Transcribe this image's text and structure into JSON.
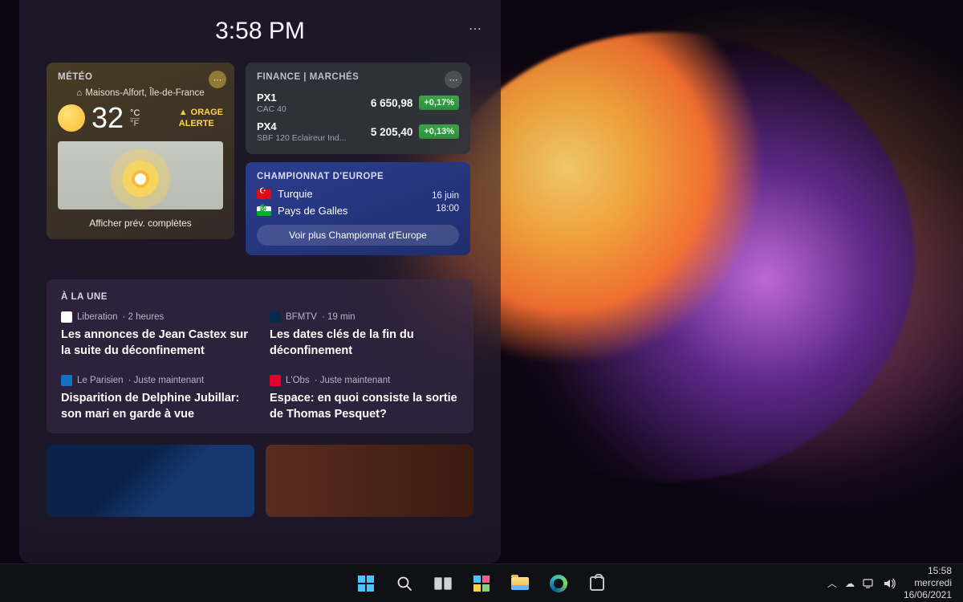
{
  "panel": {
    "clock": "3:58 PM"
  },
  "weather": {
    "title": "MÉTÉO",
    "location": "Maisons-Alfort, Île-de-France",
    "temp": "32",
    "unit_c": "°C",
    "unit_f": "°F",
    "alert_line1": "ORAGE",
    "alert_line2": "ALERTE",
    "link": "Afficher prév. complètes"
  },
  "finance": {
    "title": "FINANCE | MARCHÉS",
    "rows": [
      {
        "sym": "PX1",
        "name": "CAC 40",
        "value": "6 650,98",
        "change": "+0,17%"
      },
      {
        "sym": "PX4",
        "name": "SBF 120 Eclaireur Ind...",
        "value": "5 205,40",
        "change": "+0,13%"
      }
    ]
  },
  "sports": {
    "title": "CHAMPIONNAT D'EUROPE",
    "team1": "Turquie",
    "team2": "Pays de Galles",
    "date": "16 juin",
    "time": "18:00",
    "button": "Voir plus Championnat d'Europe"
  },
  "news": {
    "title": "À LA UNE",
    "items": [
      {
        "source": "Liberation",
        "meta": "· 2 heures",
        "headline": "Les annonces de Jean Castex sur la suite du déconfinement"
      },
      {
        "source": "BFMTV",
        "meta": "· 19 min",
        "headline": "Les dates clés de la fin du déconfinement"
      },
      {
        "source": "Le Parisien",
        "meta": "· Juste maintenant",
        "headline": "Disparition de Delphine Jubillar: son mari en garde à vue"
      },
      {
        "source": "L'Obs",
        "meta": "· Juste maintenant",
        "headline": "Espace: en quoi consiste la sortie de Thomas Pesquet?"
      }
    ]
  },
  "taskbar": {
    "time": "15:58",
    "day": "mercredi",
    "date": "16/06/2021"
  }
}
